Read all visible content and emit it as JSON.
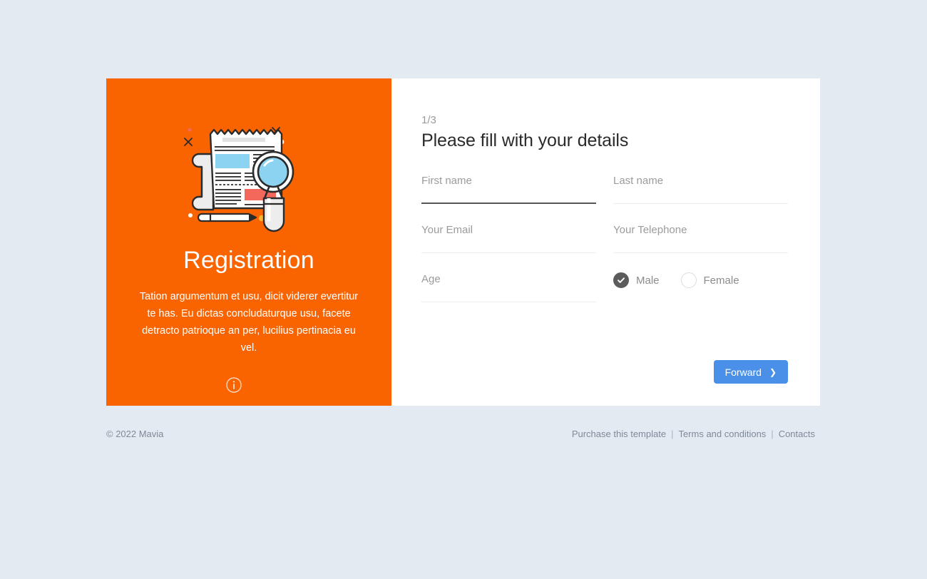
{
  "panel": {
    "title": "Registration",
    "description": "Tation argumentum et usu, dicit viderer evertitur te has. Eu dictas concludaturque usu, facete detracto patrioque an per, lucilius pertinacia eu vel.",
    "info_icon": "info-icon",
    "illustration": "newspaper-magnifier-pencil-illustration",
    "background_color": "#FA6400"
  },
  "form": {
    "step": "1/3",
    "title": "Please fill with your details",
    "fields": [
      {
        "name": "first-name",
        "label": "First name",
        "value": "",
        "active": true
      },
      {
        "name": "last-name",
        "label": "Last name",
        "value": "",
        "active": false
      },
      {
        "name": "email",
        "label": "Your Email",
        "value": "",
        "active": false
      },
      {
        "name": "telephone",
        "label": "Your Telephone",
        "value": "",
        "active": false
      },
      {
        "name": "age",
        "label": "Age",
        "value": "",
        "active": false
      }
    ],
    "gender": {
      "selected": "Male",
      "options": [
        {
          "label": "Male",
          "checked": true
        },
        {
          "label": "Female",
          "checked": false
        }
      ]
    },
    "submit": {
      "label": "Forward",
      "chevron": "chevron-right-icon",
      "color": "#4A90E8"
    }
  },
  "footer": {
    "copyright": "© 2022 Mavia",
    "separator": "|",
    "links": [
      "Purchase this template",
      "Terms and conditions",
      "Contacts"
    ]
  },
  "theme": {
    "page_background": "#E4EAF1",
    "card_background": "#FFFFFF",
    "accent_orange": "#FA6400",
    "accent_blue": "#4A90E8",
    "lens_blue": "#8BD3F0",
    "coral": "#F4685C"
  }
}
